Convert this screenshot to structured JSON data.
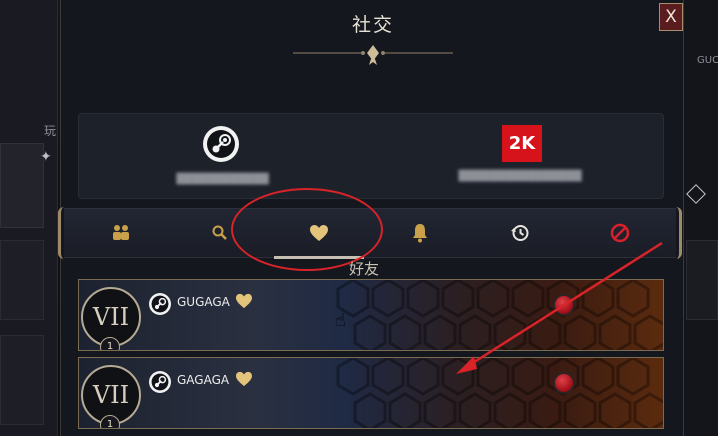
{
  "background": {
    "left_label": "玩",
    "right_label": "GUC"
  },
  "modal": {
    "title": "社交",
    "close_label": "X"
  },
  "platforms": {
    "steam": {
      "icon": "steam-logo",
      "name": "████████████"
    },
    "twok": {
      "icon": "2k-logo",
      "logo_text": "2K",
      "name": "████████████████"
    }
  },
  "tabs": [
    {
      "id": "party",
      "icon": "party-icon"
    },
    {
      "id": "search",
      "icon": "search-icon"
    },
    {
      "id": "friends",
      "icon": "heart-icon",
      "active": true
    },
    {
      "id": "notifications",
      "icon": "bell-icon"
    },
    {
      "id": "recent",
      "icon": "history-icon"
    },
    {
      "id": "blocked",
      "icon": "block-icon"
    }
  ],
  "section": {
    "title": "好友"
  },
  "friends": [
    {
      "rank": "VII",
      "level": "1",
      "platform_icon": "steam-icon",
      "name": "GUGAGA",
      "favorite": true,
      "status_color": "#c81a22"
    },
    {
      "rank": "VII",
      "level": "1",
      "platform_icon": "steam-icon",
      "name": "GAGAGA",
      "favorite": true,
      "status_color": "#c81a22"
    }
  ],
  "colors": {
    "accent_gold": "#c9a14a",
    "annotation_red": "#d82329",
    "status_red": "#c81a22"
  }
}
